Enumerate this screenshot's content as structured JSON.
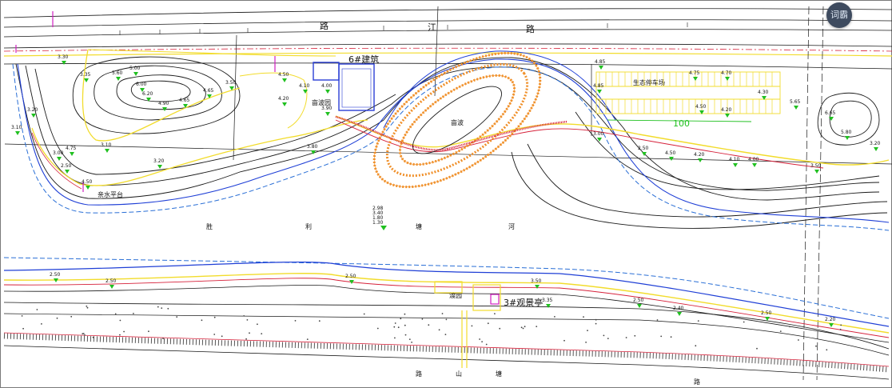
{
  "floating_button": {
    "label": "词霸"
  },
  "colors": {
    "contour": "#1a1a1a",
    "water_blue": "#1f3fd6",
    "water_dash": "#2a6fd6",
    "path_yellow": "#f2dc2c",
    "path_red": "#d6213a",
    "spiral_orange": "#f0902a",
    "accent_green": "#20c020",
    "accent_magenta": "#d020c0",
    "building_blue": "#2a3fd6"
  },
  "labels": {
    "road_top": [
      "路",
      "江",
      "路"
    ],
    "river": [
      "胜",
      "利",
      "塘",
      "河"
    ],
    "road_bottom": [
      "路",
      "山",
      "塘",
      "路"
    ],
    "building_6": "6#建筑",
    "building_3": "3#观景亭",
    "qinbo_garden": "亩波园",
    "qinbo": "亩波",
    "parking": "生态停车场",
    "water_platform": "亲水平台",
    "garden_south": "渡园",
    "dim_100": "100"
  },
  "river_elevations": [
    "2.98",
    "3.40",
    "1.80",
    "1.30"
  ],
  "elevations": {
    "north": [
      "4.50",
      "4.20",
      "4.10",
      "4.00",
      "3.90",
      "3.80",
      "5.00",
      "5.60",
      "6.00",
      "6.20",
      "4.90",
      "4.65",
      "4.65",
      "3.50",
      "3.35",
      "3.30",
      "3.20",
      "3.10",
      "3.00",
      "2.50",
      "4.50",
      "4.75",
      "4.85",
      "4.85",
      "4.75",
      "4.70",
      "4.50",
      "4.20",
      "4.30",
      "5.65",
      "6.65",
      "5.80",
      "4.50",
      "4.20",
      "4.10",
      "4.00",
      "3.50",
      "3.20",
      "3.00",
      "2.50",
      "3.20",
      "3.10"
    ],
    "south": [
      "2.50",
      "2.50",
      "2.50",
      "3.50",
      "3.35",
      "2.50",
      "2.40",
      "2.50",
      "2.20"
    ]
  }
}
